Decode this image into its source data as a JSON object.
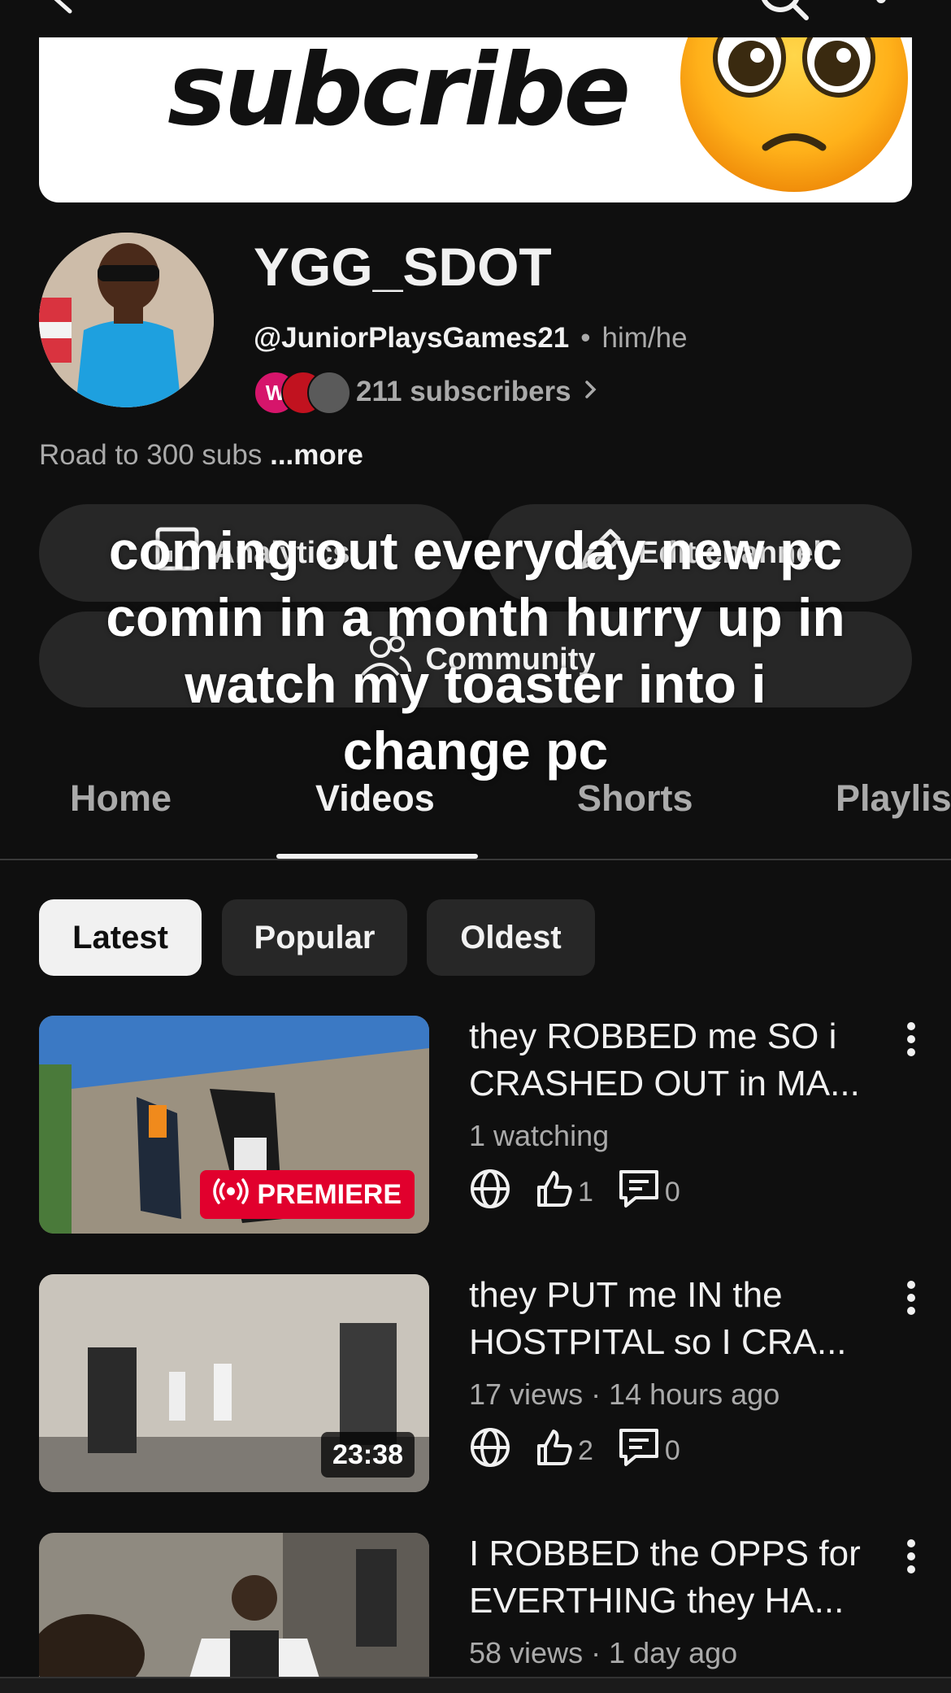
{
  "banner": {
    "text": "subcribe",
    "emoji": "pleading-face-emoji"
  },
  "channel": {
    "name": "YGG_SDOT",
    "handle": "@JuniorPlaysGames21",
    "separator": "•",
    "pronouns": "him/he",
    "subscribers": "211 subscribers",
    "subscriber_avatar_initial": "W",
    "description": "Road to 300 subs",
    "more_label": "...more"
  },
  "actions": {
    "analytics": "Analytics",
    "edit_channel": "Edit channel",
    "community": "Community"
  },
  "overlay_caption": "coming out everyday new pc comin in a month hurry up in watch my toaster into i change pc",
  "tabs": [
    {
      "label": "Home"
    },
    {
      "label": "Videos"
    },
    {
      "label": "Shorts"
    },
    {
      "label": "Playlists"
    }
  ],
  "active_tab": "Videos",
  "chips": [
    {
      "label": "Latest"
    },
    {
      "label": "Popular"
    },
    {
      "label": "Oldest"
    }
  ],
  "active_chip": "Latest",
  "videos": [
    {
      "title": "they ROBBED me SO i CRASHED OUT in MA...",
      "meta": "1 watching",
      "badge": "PREMIERE",
      "likes": "1",
      "comments": "0"
    },
    {
      "title": "they PUT me IN the HOSTPITAL so I CRA...",
      "meta": "17 views · 14 hours ago",
      "duration": "23:38",
      "likes": "2",
      "comments": "0"
    },
    {
      "title": "I ROBBED the OPPS for EVERTHING they HA...",
      "meta": "58 views · 1 day ago"
    }
  ],
  "colors": {
    "background": "#0f0f0f",
    "surface": "#272727",
    "text_primary": "#f1f1f1",
    "text_secondary": "#aaaaaa",
    "premiere_red": "#e1002d"
  }
}
